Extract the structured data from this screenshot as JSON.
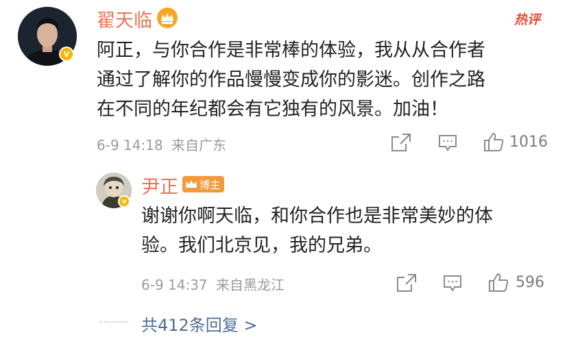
{
  "comment": {
    "username": "翟天临",
    "text_lines": [
      "阿正，与你合作是非常棒的体验，我从从合作者",
      "通过了解你的作品慢慢变成你的影迷。创作之路",
      "在不同的年纪都会有它独有的风景。加油！"
    ],
    "hot_tag": "热评",
    "date": "6-9 14:18",
    "location": "来自广东",
    "likes": "1016"
  },
  "reply": {
    "username": "尹正",
    "badge": "博主",
    "text_lines": [
      "谢谢你啊天临，和你合作也是非常美妙的体",
      "验。我们北京见，我的兄弟。"
    ],
    "date": "6-9 14:37",
    "location": "来自黑龙江",
    "likes": "596"
  },
  "more_replies": "共412条回复 >",
  "colors": {
    "username": "#eb7350",
    "hot_tag": "#e94b36",
    "link": "#4e6d9a",
    "verified": "#f7b500"
  }
}
